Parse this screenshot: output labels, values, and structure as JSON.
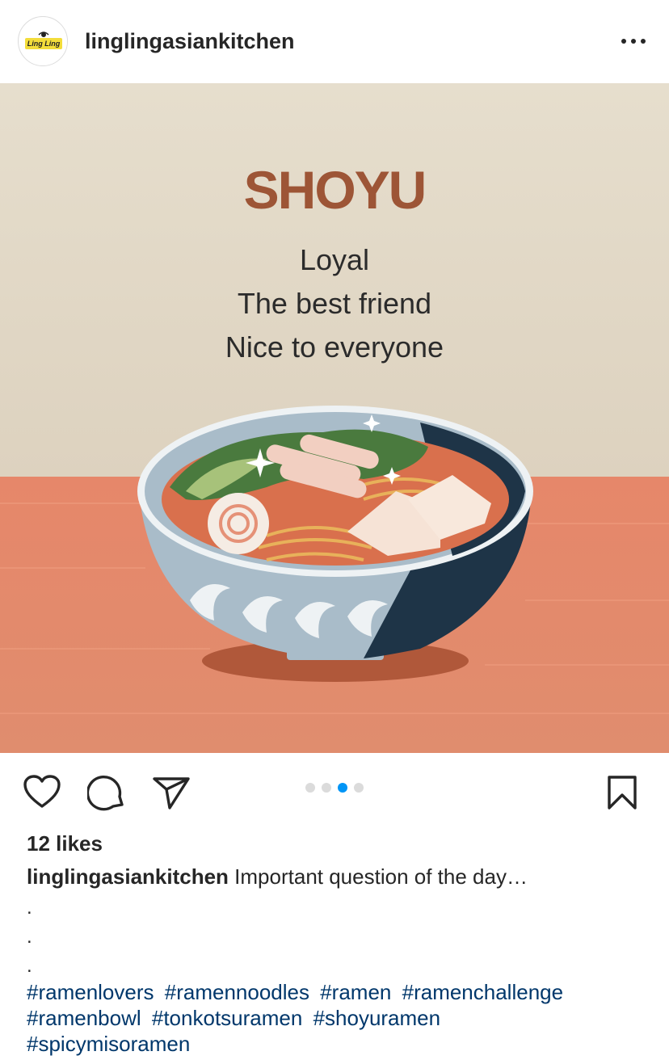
{
  "header": {
    "avatar_logo_text": "Ling Ling",
    "username": "linglingasiankitchen",
    "more_icon": "more-horizontal-icon"
  },
  "post": {
    "title": "SHOYU",
    "lines": [
      "Loyal",
      "The best friend",
      "Nice to everyone"
    ],
    "colors": {
      "wall": "#e3dac9",
      "table": "#e3896a",
      "title": "#9d5536",
      "bowl_light": "#a9bcc9",
      "bowl_dark": "#1e3447"
    }
  },
  "actions": {
    "like_icon": "heart-icon",
    "comment_icon": "comment-icon",
    "share_icon": "paper-plane-icon",
    "save_icon": "bookmark-icon",
    "carousel": {
      "count": 4,
      "active": 3
    }
  },
  "likes": "12 likes",
  "caption": {
    "username": "linglingasiankitchen",
    "text": "Important question of the day…",
    "periods": [
      ".",
      ".",
      "."
    ]
  },
  "hashtags": [
    "#ramenlovers",
    "#ramennoodles",
    "#ramen",
    "#ramenchallenge",
    "#ramenbowl",
    "#tonkotsuramen",
    "#shoyuramen",
    "#spicymisoramen"
  ],
  "accent_color": "#0095f6",
  "link_color": "#00376b"
}
